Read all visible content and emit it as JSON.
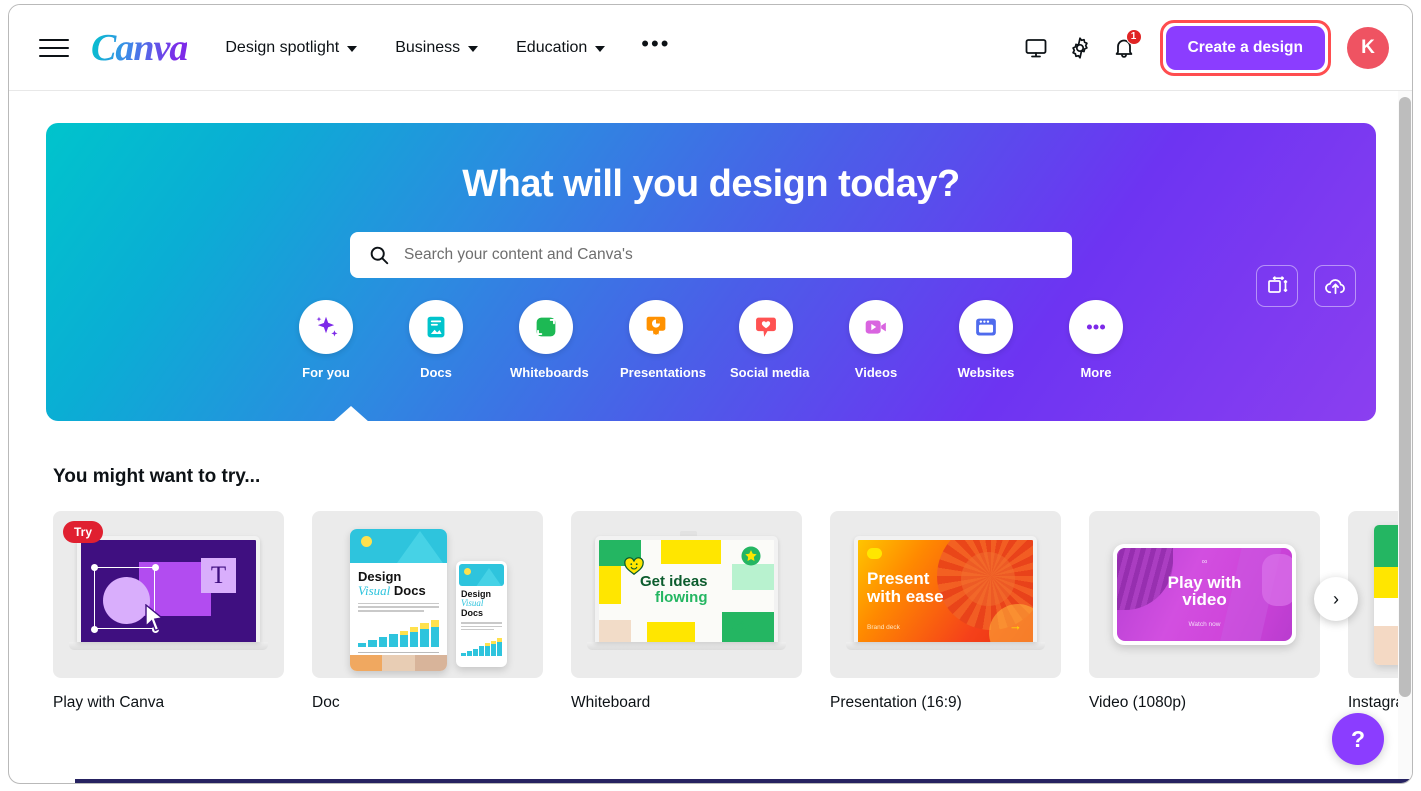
{
  "topnav": {
    "brand": "Canva",
    "menu_icon": "hamburger-icon",
    "items": [
      {
        "label": "Design spotlight"
      },
      {
        "label": "Business"
      },
      {
        "label": "Education"
      }
    ],
    "more_label": "•••",
    "display_icon": "monitor-icon",
    "settings_icon": "gear-icon",
    "notifications_icon": "bell-icon",
    "notification_count": "1",
    "create_label": "Create a design",
    "avatar_initial": "K",
    "accent_purple": "#8b3dff",
    "highlight_red": "#ff4d4f",
    "avatar_color": "#ef5362"
  },
  "hero": {
    "title": "What will you design today?",
    "search_placeholder": "Search your content and Canva's",
    "search_value": "",
    "gradient_from": "#00c4cc",
    "gradient_to": "#8b3ff0",
    "actions": [
      {
        "name": "custom-size-icon"
      },
      {
        "name": "cloud-upload-icon"
      }
    ],
    "categories": [
      {
        "label": "For you",
        "icon": "sparkle-icon",
        "color": "#7d2ae8",
        "active": true
      },
      {
        "label": "Docs",
        "icon": "document-icon",
        "color": "#00c4cc",
        "active": false
      },
      {
        "label": "Whiteboards",
        "icon": "whiteboard-icon",
        "color": "#1db954",
        "active": false
      },
      {
        "label": "Presentations",
        "icon": "presentation-icon",
        "color": "#ff9100",
        "active": false
      },
      {
        "label": "Social media",
        "icon": "heart-bubble-icon",
        "color": "#ff5252",
        "active": false
      },
      {
        "label": "Videos",
        "icon": "video-camera-icon",
        "color": "#d964e0",
        "active": false
      },
      {
        "label": "Websites",
        "icon": "browser-icon",
        "color": "#4f6bed",
        "active": false
      },
      {
        "label": "More",
        "icon": "ellipsis-icon",
        "color": "#7d2ae8",
        "active": false
      }
    ]
  },
  "suggestions": {
    "title": "You might want to try...",
    "badge": "Try",
    "next_label": "›",
    "cards": [
      {
        "label": "Play with Canva",
        "art": "play-with-canva",
        "art_text": "T"
      },
      {
        "label": "Doc",
        "art": "doc",
        "art_text": "Design Visual Docs"
      },
      {
        "label": "Whiteboard",
        "art": "whiteboard",
        "art_text": "Get ideas flowing"
      },
      {
        "label": "Presentation (16:9)",
        "art": "presentation",
        "art_text": "Present with ease",
        "art_sub": "Brand deck"
      },
      {
        "label": "Video (1080p)",
        "art": "video",
        "art_text": "Play with video",
        "art_sub": "Watch now"
      },
      {
        "label": "Instagram Post (Squa",
        "art": "instagram",
        "art_text": ""
      }
    ]
  },
  "help": {
    "label": "?"
  }
}
